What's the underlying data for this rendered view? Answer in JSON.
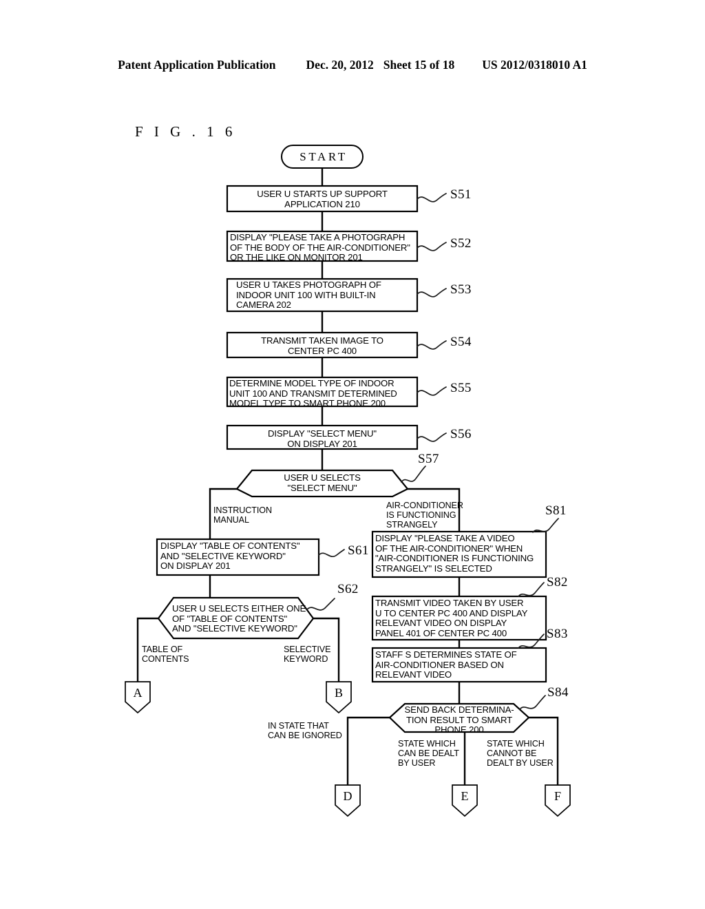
{
  "header": {
    "publication": "Patent Application Publication",
    "date": "Dec. 20, 2012",
    "sheet": "Sheet 15 of 18",
    "docnumber": "US 2012/0318010 A1"
  },
  "figure": {
    "label": "F I G .   1 6"
  },
  "terminator": {
    "start": "START"
  },
  "steps": {
    "s51": {
      "code": "S51",
      "text": "USER U STARTS UP SUPPORT\nAPPLICATION 210"
    },
    "s52": {
      "code": "S52",
      "text": "DISPLAY \"PLEASE TAKE A PHOTOGRAPH\nOF THE BODY OF THE AIR-CONDITIONER\"\nOR THE LIKE ON MONITOR 201"
    },
    "s53": {
      "code": "S53",
      "text": "USER U TAKES PHOTOGRAPH OF\nINDOOR UNIT 100 WITH BUILT-IN\nCAMERA 202"
    },
    "s54": {
      "code": "S54",
      "text": "TRANSMIT TAKEN IMAGE TO\nCENTER PC 400"
    },
    "s55": {
      "code": "S55",
      "text": "DETERMINE MODEL TYPE OF INDOOR\nUNIT 100 AND TRANSMIT DETERMINED\nMODEL TYPE TO SMART PHONE 200"
    },
    "s56": {
      "code": "S56",
      "text": "DISPLAY \"SELECT MENU\"\nON DISPLAY 201"
    },
    "s57": {
      "code": "S57",
      "text": "USER U SELECTS\n\"SELECT MENU\""
    },
    "s61": {
      "code": "S61",
      "text": "DISPLAY \"TABLE OF CONTENTS\"\nAND \"SELECTIVE KEYWORD\"\nON DISPLAY 201"
    },
    "s62": {
      "code": "S62",
      "text": "USER U SELECTS EITHER ONE\nOF \"TABLE OF CONTENTS\"\nAND \"SELECTIVE KEYWORD\""
    },
    "s81": {
      "code": "S81",
      "text": "DISPLAY \"PLEASE TAKE A VIDEO\nOF THE AIR-CONDITIONER\" WHEN\n\"AIR-CONDITIONER IS FUNCTIONING\nSTRANGELY\" IS SELECTED"
    },
    "s82": {
      "code": "S82",
      "text": "TRANSMIT VIDEO TAKEN BY USER\nU TO CENTER PC 400 AND DISPLAY\nRELEVANT VIDEO ON DISPLAY\nPANEL 401 OF CENTER PC 400"
    },
    "s83": {
      "code": "S83",
      "text": "STAFF S DETERMINES STATE OF\nAIR-CONDITIONER BASED ON\nRELEVANT VIDEO"
    },
    "s84": {
      "code": "S84",
      "text": "SEND BACK DETERMINA-\nTION RESULT TO SMART\nPHONE 200"
    }
  },
  "branches": {
    "instruction_manual": "INSTRUCTION\nMANUAL",
    "functioning_strangely": "AIR-CONDITIONER\nIS FUNCTIONING\nSTRANGELY",
    "table_of_contents": "TABLE OF\nCONTENTS",
    "selective_keyword": "SELECTIVE\nKEYWORD",
    "can_be_ignored": "IN STATE THAT\nCAN BE IGNORED",
    "can_be_dealt": "STATE WHICH\nCAN BE DEALT\nBY USER",
    "cannot_be_dealt": "STATE WHICH\nCANNOT BE\nDEALT BY USER"
  },
  "connectors": {
    "a": "A",
    "b": "B",
    "d": "D",
    "e": "E",
    "f": "F"
  },
  "colors": {
    "ink": "#000000",
    "paper": "#ffffff"
  }
}
